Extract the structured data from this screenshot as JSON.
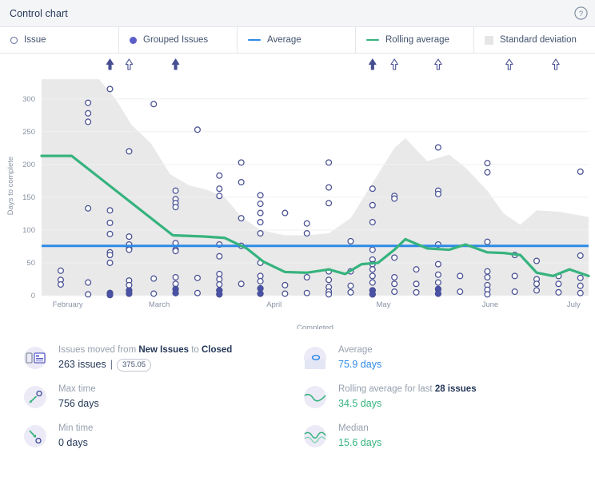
{
  "header": {
    "title": "Control chart",
    "help_icon": "help-circle-icon"
  },
  "legend": {
    "items": [
      {
        "label": "Issue",
        "marker": "ring",
        "color": "#5e6c9b"
      },
      {
        "label": "Grouped Issues",
        "marker": "dot",
        "color": "#5b5fc7"
      },
      {
        "label": "Average",
        "marker": "line",
        "color": "#2e8ae6"
      },
      {
        "label": "Rolling average",
        "marker": "line",
        "color": "#36b37e"
      },
      {
        "label": "Standard deviation",
        "marker": "box",
        "color": "#e6e6e6"
      }
    ]
  },
  "chart_data": {
    "type": "scatter",
    "title": "Control chart",
    "xlabel": "Completed",
    "ylabel": "Days to complete",
    "ylim": [
      0,
      335
    ],
    "yticks": [
      0,
      50,
      100,
      150,
      200,
      250,
      300
    ],
    "xticks": [
      "February",
      "March",
      "April",
      "May",
      "June",
      "July"
    ],
    "xtick_positions": [
      0.02,
      0.215,
      0.425,
      0.625,
      0.82,
      0.985
    ],
    "grid": true,
    "legend_position": "top",
    "average": 75.9,
    "average_color": "#2e8ae6",
    "rolling_average_color": "#36b37e",
    "std_band_color": "#e9e9e9",
    "series": [
      {
        "name": "Rolling average",
        "type": "line",
        "points": [
          [
            0.0,
            213
          ],
          [
            0.055,
            213
          ],
          [
            0.24,
            92
          ],
          [
            0.3,
            90
          ],
          [
            0.335,
            88
          ],
          [
            0.375,
            72
          ],
          [
            0.405,
            52
          ],
          [
            0.445,
            36
          ],
          [
            0.485,
            35
          ],
          [
            0.525,
            40
          ],
          [
            0.555,
            33
          ],
          [
            0.585,
            48
          ],
          [
            0.615,
            50
          ],
          [
            0.645,
            70
          ],
          [
            0.665,
            86
          ],
          [
            0.705,
            72
          ],
          [
            0.745,
            70
          ],
          [
            0.775,
            78
          ],
          [
            0.815,
            66
          ],
          [
            0.845,
            65
          ],
          [
            0.875,
            62
          ],
          [
            0.905,
            35
          ],
          [
            0.935,
            30
          ],
          [
            0.965,
            40
          ],
          [
            1.0,
            30
          ]
        ]
      },
      {
        "name": "Standard deviation",
        "type": "area",
        "points": [
          [
            0.0,
            330
          ],
          [
            0.105,
            330
          ],
          [
            0.135,
            300
          ],
          [
            0.165,
            260
          ],
          [
            0.2,
            232
          ],
          [
            0.235,
            185
          ],
          [
            0.27,
            168
          ],
          [
            0.3,
            162
          ],
          [
            0.335,
            150
          ],
          [
            0.365,
            120
          ],
          [
            0.4,
            100
          ],
          [
            0.445,
            92
          ],
          [
            0.485,
            92
          ],
          [
            0.525,
            95
          ],
          [
            0.565,
            118
          ],
          [
            0.6,
            165
          ],
          [
            0.645,
            225
          ],
          [
            0.665,
            240
          ],
          [
            0.705,
            205
          ],
          [
            0.745,
            215
          ],
          [
            0.775,
            195
          ],
          [
            0.815,
            160
          ],
          [
            0.845,
            125
          ],
          [
            0.875,
            108
          ],
          [
            0.905,
            130
          ],
          [
            0.945,
            128
          ],
          [
            1.0,
            120
          ]
        ]
      },
      {
        "name": "Issues",
        "type": "scatter",
        "points": [
          [
            0.035,
            38
          ],
          [
            0.035,
            24
          ],
          [
            0.035,
            17
          ],
          [
            0.085,
            294
          ],
          [
            0.085,
            278
          ],
          [
            0.085,
            265
          ],
          [
            0.085,
            133
          ],
          [
            0.085,
            20
          ],
          [
            0.085,
            2
          ],
          [
            0.125,
            315
          ],
          [
            0.125,
            130
          ],
          [
            0.125,
            111
          ],
          [
            0.125,
            94
          ],
          [
            0.125,
            66
          ],
          [
            0.125,
            62
          ],
          [
            0.125,
            50
          ],
          [
            0.125,
            4
          ],
          [
            0.125,
            1
          ],
          [
            0.16,
            220
          ],
          [
            0.16,
            90
          ],
          [
            0.16,
            78
          ],
          [
            0.16,
            72
          ],
          [
            0.16,
            70
          ],
          [
            0.16,
            23
          ],
          [
            0.16,
            16
          ],
          [
            0.16,
            8
          ],
          [
            0.16,
            3
          ],
          [
            0.205,
            292
          ],
          [
            0.205,
            26
          ],
          [
            0.205,
            3
          ],
          [
            0.245,
            160
          ],
          [
            0.245,
            147
          ],
          [
            0.245,
            141
          ],
          [
            0.245,
            135
          ],
          [
            0.245,
            80
          ],
          [
            0.245,
            70
          ],
          [
            0.245,
            68
          ],
          [
            0.245,
            28
          ],
          [
            0.245,
            18
          ],
          [
            0.245,
            10
          ],
          [
            0.245,
            4
          ],
          [
            0.285,
            253
          ],
          [
            0.285,
            27
          ],
          [
            0.285,
            4
          ],
          [
            0.325,
            183
          ],
          [
            0.325,
            163
          ],
          [
            0.325,
            152
          ],
          [
            0.325,
            78
          ],
          [
            0.325,
            60
          ],
          [
            0.325,
            33
          ],
          [
            0.325,
            25
          ],
          [
            0.325,
            17
          ],
          [
            0.325,
            8
          ],
          [
            0.325,
            2
          ],
          [
            0.365,
            203
          ],
          [
            0.365,
            173
          ],
          [
            0.365,
            118
          ],
          [
            0.365,
            76
          ],
          [
            0.365,
            18
          ],
          [
            0.4,
            153
          ],
          [
            0.4,
            140
          ],
          [
            0.4,
            126
          ],
          [
            0.4,
            112
          ],
          [
            0.4,
            95
          ],
          [
            0.4,
            50
          ],
          [
            0.4,
            30
          ],
          [
            0.4,
            22
          ],
          [
            0.4,
            11
          ],
          [
            0.4,
            3
          ],
          [
            0.445,
            126
          ],
          [
            0.445,
            16
          ],
          [
            0.445,
            3
          ],
          [
            0.485,
            110
          ],
          [
            0.485,
            95
          ],
          [
            0.485,
            28
          ],
          [
            0.485,
            4
          ],
          [
            0.525,
            203
          ],
          [
            0.525,
            165
          ],
          [
            0.525,
            141
          ],
          [
            0.525,
            37
          ],
          [
            0.525,
            24
          ],
          [
            0.525,
            13
          ],
          [
            0.525,
            6
          ],
          [
            0.525,
            2
          ],
          [
            0.565,
            83
          ],
          [
            0.565,
            37
          ],
          [
            0.565,
            15
          ],
          [
            0.565,
            5
          ],
          [
            0.605,
            163
          ],
          [
            0.605,
            138
          ],
          [
            0.605,
            112
          ],
          [
            0.605,
            70
          ],
          [
            0.605,
            55
          ],
          [
            0.605,
            48
          ],
          [
            0.605,
            40
          ],
          [
            0.605,
            30
          ],
          [
            0.605,
            20
          ],
          [
            0.605,
            8
          ],
          [
            0.605,
            2
          ],
          [
            0.645,
            152
          ],
          [
            0.645,
            148
          ],
          [
            0.645,
            58
          ],
          [
            0.645,
            28
          ],
          [
            0.645,
            18
          ],
          [
            0.645,
            6
          ],
          [
            0.685,
            40
          ],
          [
            0.685,
            18
          ],
          [
            0.685,
            5
          ],
          [
            0.725,
            226
          ],
          [
            0.725,
            160
          ],
          [
            0.725,
            155
          ],
          [
            0.725,
            78
          ],
          [
            0.725,
            48
          ],
          [
            0.725,
            32
          ],
          [
            0.725,
            20
          ],
          [
            0.725,
            10
          ],
          [
            0.725,
            3
          ],
          [
            0.765,
            30
          ],
          [
            0.765,
            6
          ],
          [
            0.815,
            202
          ],
          [
            0.815,
            188
          ],
          [
            0.815,
            82
          ],
          [
            0.815,
            37
          ],
          [
            0.815,
            28
          ],
          [
            0.815,
            16
          ],
          [
            0.815,
            9
          ],
          [
            0.815,
            2
          ],
          [
            0.865,
            62
          ],
          [
            0.865,
            30
          ],
          [
            0.865,
            6
          ],
          [
            0.905,
            53
          ],
          [
            0.905,
            25
          ],
          [
            0.905,
            18
          ],
          [
            0.905,
            8
          ],
          [
            0.945,
            30
          ],
          [
            0.945,
            18
          ],
          [
            0.945,
            5
          ],
          [
            0.985,
            189
          ],
          [
            0.985,
            61
          ],
          [
            0.985,
            27
          ],
          [
            0.985,
            15
          ],
          [
            0.985,
            4
          ]
        ]
      }
    ],
    "outlier_markers": [
      {
        "x": 0.125,
        "filled": true
      },
      {
        "x": 0.16,
        "filled": false
      },
      {
        "x": 0.245,
        "filled": true
      },
      {
        "x": 0.605,
        "filled": true
      },
      {
        "x": 0.645,
        "filled": false
      },
      {
        "x": 0.725,
        "filled": false
      },
      {
        "x": 0.855,
        "filled": false
      },
      {
        "x": 0.94,
        "filled": false
      }
    ]
  },
  "stats": {
    "left": [
      {
        "icon": "board-transition-icon",
        "label_prefix": "Issues moved from ",
        "label_from": "New Issues",
        "label_mid": " to ",
        "label_to": "Closed",
        "value": "263 issues",
        "separator": "|",
        "badge": "375.05"
      },
      {
        "icon": "max-time-arrow-up-icon",
        "label": "Max time",
        "value": "756 days"
      },
      {
        "icon": "min-time-arrow-down-icon",
        "label": "Min time",
        "value": "0 days"
      }
    ],
    "right": [
      {
        "icon": "average-ellipse-icon",
        "label": "Average",
        "value": "75.9 days"
      },
      {
        "icon": "rolling-average-wave-icon",
        "label_prefix": "Rolling average for last ",
        "label_bold": "28 issues",
        "value": "34.5 days"
      },
      {
        "icon": "median-zigzag-icon",
        "label": "Median",
        "value": "15.6 days"
      }
    ]
  }
}
